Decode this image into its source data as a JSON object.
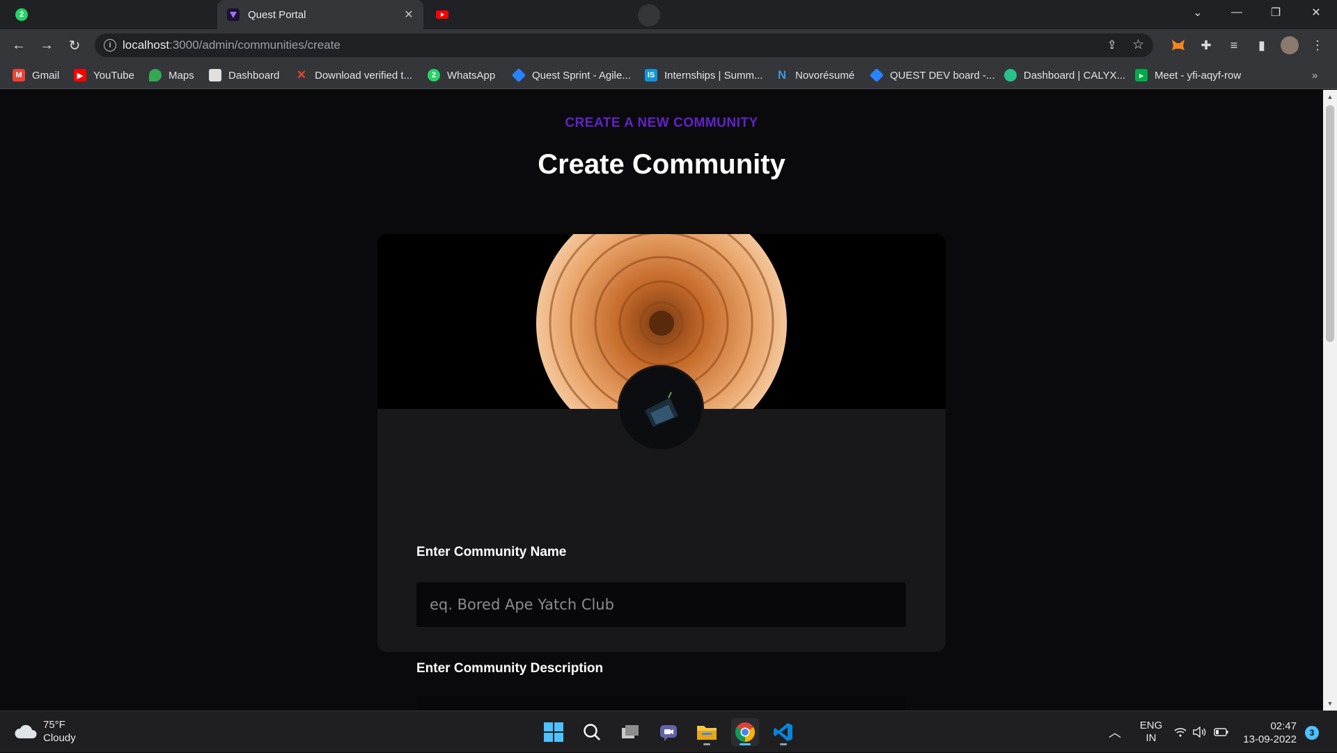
{
  "browser": {
    "tabs": [
      {
        "title": "",
        "favicon": "whatsapp-icon",
        "badge": "2"
      },
      {
        "title": "Quest Portal",
        "favicon": "quest-portal-icon",
        "active": true
      },
      {
        "title": "",
        "favicon": "youtube-icon"
      }
    ],
    "address": {
      "host": "localhost",
      "path": ":3000/admin/communities/create"
    },
    "bookmarks": [
      {
        "label": "Gmail",
        "icon": "gmail-icon",
        "color": "#ea4335"
      },
      {
        "label": "YouTube",
        "icon": "youtube-icon",
        "color": "#ff0000"
      },
      {
        "label": "Maps",
        "icon": "maps-icon",
        "color": "#34a853"
      },
      {
        "label": "Dashboard",
        "icon": "dashboard-icon",
        "color": "#8b8b8b"
      },
      {
        "label": "Download verified t...",
        "icon": "x-icon",
        "color": "#e8452c"
      },
      {
        "label": "WhatsApp",
        "icon": "whatsapp-icon",
        "color": "#25d366"
      },
      {
        "label": "Quest Sprint - Agile...",
        "icon": "jira-icon",
        "color": "#2684ff"
      },
      {
        "label": "Internships | Summ...",
        "icon": "internshala-icon",
        "color": "#1295d8"
      },
      {
        "label": "Novorésumé",
        "icon": "novoresume-icon",
        "color": "#3a9ad9"
      },
      {
        "label": "QUEST DEV board -...",
        "icon": "jira-icon",
        "color": "#2684ff"
      },
      {
        "label": "Dashboard | CALYX...",
        "icon": "calyx-icon",
        "color": "#27c28a"
      },
      {
        "label": "Meet - yfi-aqyf-row",
        "icon": "meet-icon",
        "color": "#00ac47"
      }
    ]
  },
  "page": {
    "eyebrow": "CREATE A NEW COMMUNITY",
    "title": "Create Community",
    "name_field": {
      "label": "Enter Community Name",
      "placeholder": "eq. Bored Ape Yatch Club",
      "value": ""
    },
    "description_field": {
      "label": "Enter Community Description"
    }
  },
  "taskbar": {
    "weather": {
      "temp": "75°F",
      "condition": "Cloudy"
    },
    "language": {
      "line1": "ENG",
      "line2": "IN"
    },
    "time": "02:47",
    "date": "13-09-2022",
    "notifications": "3"
  },
  "colors": {
    "accent": "#6222c9",
    "page_bg": "#0a0a0c",
    "card_bg": "#18181b"
  }
}
